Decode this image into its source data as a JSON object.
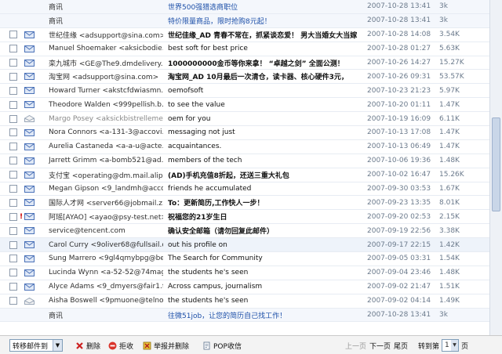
{
  "rows": [
    {
      "checkbox": false,
      "icon": "none",
      "from": "商讯",
      "subject": "世界500强猎选商职位",
      "subject_style": "link",
      "date": "2007-10-28 13:41",
      "size": "3k",
      "type": "top"
    },
    {
      "checkbox": false,
      "icon": "none",
      "from": "商讯",
      "subject": "特价限量商品，限时抢购8元起！",
      "subject_style": "link",
      "date": "2007-10-28 13:41",
      "size": "3k",
      "type": "top"
    },
    {
      "checkbox": true,
      "icon": "unread",
      "from": "世纪佳缘 <adsupport@sina.com>",
      "subject": "世纪佳缘_AD 青春不常在，抓紧谈恋爱！ 男大当婚女大当嫁",
      "subject_style": "bold",
      "date": "2007-10-28 14:08",
      "size": "3.54K",
      "type": "normal"
    },
    {
      "checkbox": true,
      "icon": "unread",
      "from": "Manuel Shoemaker <aksicbodie...",
      "subject": "best soft for best price",
      "subject_style": "normal",
      "date": "2007-10-28 01:27",
      "size": "5.63K",
      "type": "normal"
    },
    {
      "checkbox": true,
      "icon": "unread",
      "from": "栾九城市 <GE@The9.dmdelivery...",
      "subject": "1000000000金币等你来拿！ “卓越之剑” 全面公测！",
      "subject_style": "bold",
      "date": "2007-10-26 14:27",
      "size": "15.27K",
      "type": "normal"
    },
    {
      "checkbox": true,
      "icon": "unread",
      "from": "淘宝网 <adsupport@sina.com>",
      "subject": "淘宝网_AD 10月最后一次清仓，读卡器、核心硬件3元，",
      "subject_style": "bold",
      "date": "2007-10-26 09:31",
      "size": "53.57K",
      "type": "normal"
    },
    {
      "checkbox": true,
      "icon": "unread",
      "from": "Howard Turner <akstcfdwiasmn...",
      "subject": "oemofsoft",
      "subject_style": "normal",
      "date": "2007-10-23 21:23",
      "size": "5.97K",
      "type": "normal"
    },
    {
      "checkbox": true,
      "icon": "unread",
      "from": "Theodore Walden <999pellish.b...",
      "subject": "to see the value",
      "subject_style": "normal",
      "date": "2007-10-20 01:11",
      "size": "1.47K",
      "type": "normal"
    },
    {
      "checkbox": true,
      "icon": "read",
      "from": "Margo Posey <aksickbistrelleme...",
      "subject": "oem for you",
      "subject_style": "normal",
      "date": "2007-10-19 16:09",
      "size": "6.11K",
      "type": "dim"
    },
    {
      "checkbox": true,
      "icon": "unread",
      "from": "Nora Connors <a-131-3@accovi...",
      "subject": "messaging not just",
      "subject_style": "normal",
      "date": "2007-10-13 17:08",
      "size": "1.47K",
      "type": "normal"
    },
    {
      "checkbox": true,
      "icon": "unread",
      "from": "Aurelia Castaneda <a-a-u@acte...",
      "subject": "acquaintances.",
      "subject_style": "normal",
      "date": "2007-10-13 06:49",
      "size": "1.47K",
      "type": "normal"
    },
    {
      "checkbox": true,
      "icon": "unread",
      "from": "Jarrett Grimm <a-bomb521@ad...",
      "subject": "members of the tech",
      "subject_style": "normal",
      "date": "2007-10-06 19:36",
      "size": "1.48K",
      "type": "normal"
    },
    {
      "checkbox": true,
      "icon": "unread",
      "from": "支付宝 <operating@dm.mail.alip...",
      "subject": "(AD)手机充值8折起，还送三重大礼包",
      "subject_style": "bold",
      "date": "2007-10-02 16:47",
      "size": "15.26K",
      "type": "normal"
    },
    {
      "checkbox": true,
      "icon": "unread",
      "from": "Megan Gipson <9_landmh@accov...",
      "subject": "friends he accumulated",
      "subject_style": "normal",
      "date": "2007-09-30 03:53",
      "size": "1.67K",
      "type": "normal"
    },
    {
      "checkbox": true,
      "icon": "unread",
      "from": "国际人才网 <server66@jobmail.z...",
      "subject": "To：更新简历,工作快人一步！",
      "subject_style": "bold",
      "date": "2007-09-23 13:35",
      "size": "8.01K",
      "type": "normal"
    },
    {
      "checkbox": true,
      "icon": "flag",
      "from": "阿瑶[AYAO] <ayao@psy-test.net>",
      "subject": "祝福您的21岁生日",
      "subject_style": "bold",
      "date": "2007-09-20 02:53",
      "size": "2.15K",
      "type": "normal"
    },
    {
      "checkbox": true,
      "icon": "unread",
      "from": "service@tencent.com",
      "subject": "确认安全邮箱（请勿回复此邮件）",
      "subject_style": "bold",
      "date": "2007-09-19 22:56",
      "size": "3.38K",
      "type": "normal"
    },
    {
      "checkbox": true,
      "icon": "unread",
      "from": "Carol Curry <9oliver68@fullsail.c...",
      "subject": "out his profile on",
      "subject_style": "normal",
      "date": "2007-09-17 22:15",
      "size": "1.42K",
      "type": "hover"
    },
    {
      "checkbox": true,
      "icon": "unread",
      "from": "Sung Marrero <9gl4qmybpg@be...",
      "subject": "The Search for Community",
      "subject_style": "normal",
      "date": "2007-09-05 03:31",
      "size": "1.54K",
      "type": "normal"
    },
    {
      "checkbox": true,
      "icon": "unread",
      "from": "Lucinda Wynn <a-52-52@74mag...",
      "subject": "the students he's seen",
      "subject_style": "normal",
      "date": "2007-09-04 23:46",
      "size": "1.48K",
      "type": "normal"
    },
    {
      "checkbox": true,
      "icon": "unread",
      "from": "Alyce Adams <9_dmyers@fair1.f...",
      "subject": "Across campus, journalism",
      "subject_style": "normal",
      "date": "2007-09-02 21:47",
      "size": "1.51K",
      "type": "normal"
    },
    {
      "checkbox": true,
      "icon": "read",
      "from": "Aisha Boswell <9pmuone@telnor...",
      "subject": "the students he's seen",
      "subject_style": "normal",
      "date": "2007-09-02 04:14",
      "size": "1.49K",
      "type": "normal"
    },
    {
      "checkbox": false,
      "icon": "none",
      "from": "商讯",
      "subject": "往微51job，让您的简历自己找工作！",
      "subject_style": "link",
      "date": "2007-10-28 13:41",
      "size": "3k",
      "type": "top"
    }
  ],
  "toolbar": {
    "move_to": "转移邮件到",
    "delete": "删除",
    "reject": "拒收",
    "report_delete": "举报并删除",
    "pop_receive": "POP收信",
    "prev_page": "上一页",
    "next_page": "下一页",
    "last_page": "尾页",
    "goto_label": "转到第",
    "page_value": "1",
    "page_unit": "页"
  },
  "colors": {
    "link": "#1c4fa8",
    "envelope": "#4b72b8",
    "flag": "#cc0000"
  }
}
